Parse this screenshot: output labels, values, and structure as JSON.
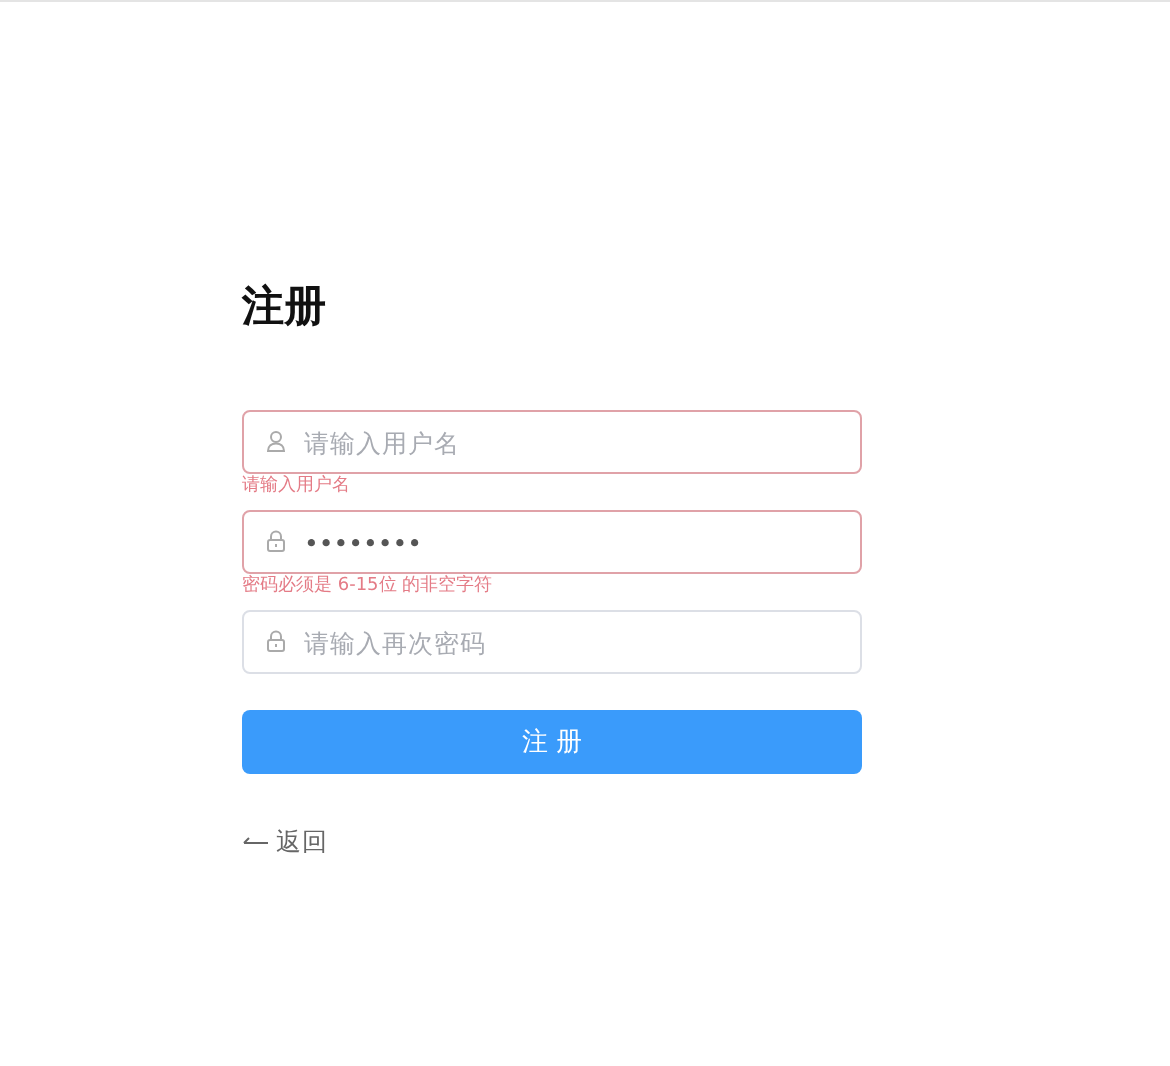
{
  "title": "注册",
  "fields": [
    {
      "kind": "user",
      "placeholder": "请输入用户名",
      "invalid": true,
      "error": "请输入用户名"
    },
    {
      "kind": "lock",
      "value": "••••••••",
      "invalid": true,
      "error": "密码必须是 6-15位 的非空字符"
    },
    {
      "kind": "lock",
      "placeholder": "请输入再次密码",
      "invalid": false
    }
  ],
  "submit": "注 册",
  "back": "返回"
}
